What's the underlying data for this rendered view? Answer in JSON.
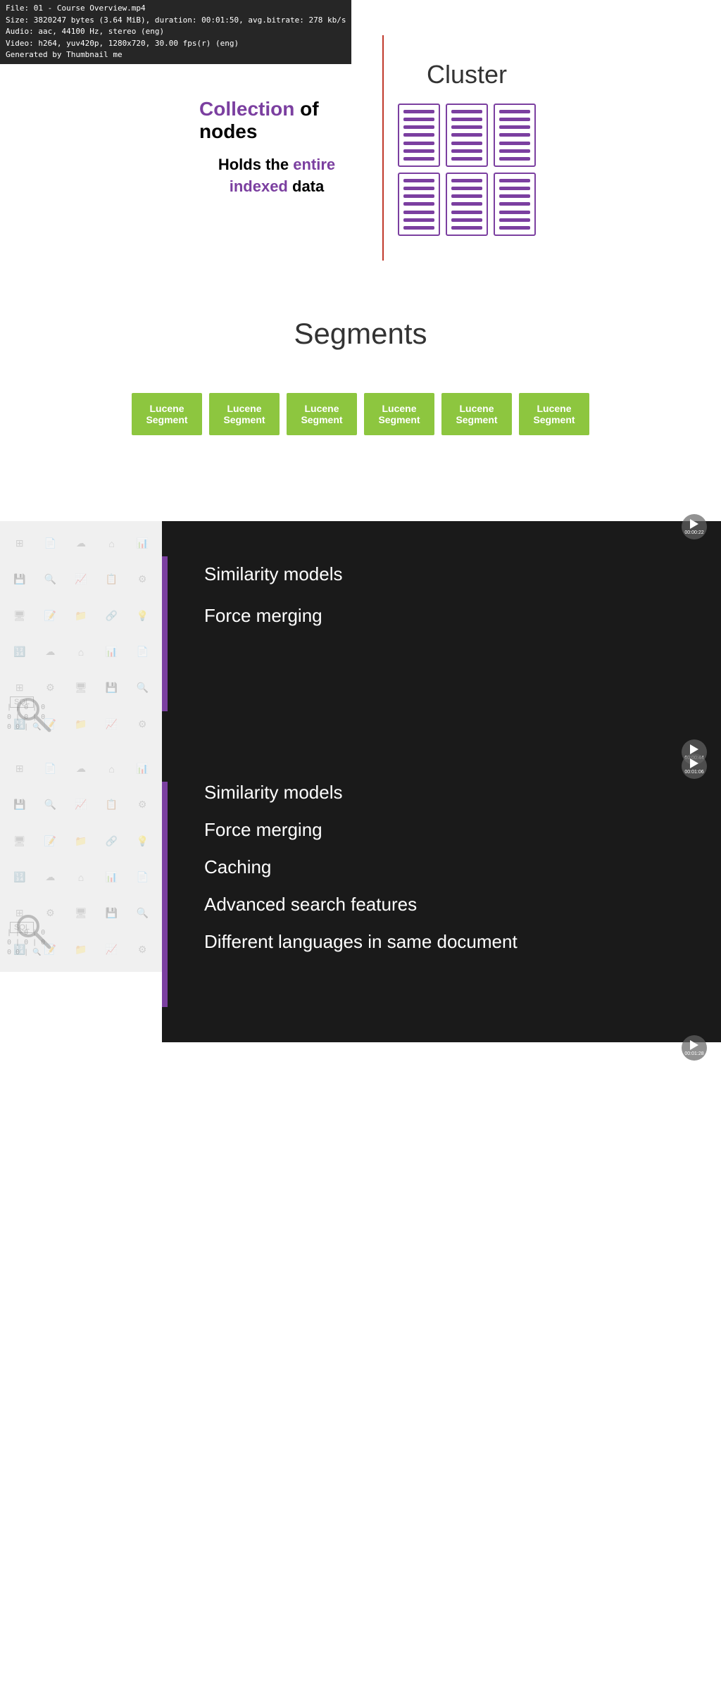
{
  "fileInfo": {
    "line1": "File: 01 - Course Overview.mp4",
    "line2": "Size: 3820247 bytes (3.64 MiB), duration: 00:01:50, avg.bitrate: 278 kb/s",
    "line3": "Audio: aac, 44100 Hz, stereo (eng)",
    "line4": "Video: h264, yuv420p, 1280x720, 30.00 fps(r) (eng)",
    "line5": "Generated by Thumbnail me"
  },
  "section1": {
    "title": "Cluster",
    "leftText1": "Collection of nodes",
    "leftText2_prefix": "Holds the",
    "leftText2_highlight": "entire indexed",
    "leftText2_suffix": "data"
  },
  "section2": {
    "title": "Segments",
    "segments": [
      {
        "label": "Lucene Segment"
      },
      {
        "label": "Lucene Segment"
      },
      {
        "label": "Lucene Segment"
      },
      {
        "label": "Lucene Segment"
      },
      {
        "label": "Lucene Segment"
      },
      {
        "label": "Lucene Segment"
      }
    ],
    "timestamp": "00:00:22"
  },
  "section3": {
    "timestamp": "00:00:44",
    "topics": [
      "Similarity models",
      "Force merging"
    ]
  },
  "section4": {
    "timestamp": "00:01:06",
    "topics": [
      "Similarity models",
      "Force merging",
      "Caching",
      "Advanced search features",
      "Different languages in same document"
    ],
    "timestamp2": "00:01:28"
  },
  "icons": {
    "patternIcons": [
      "📊",
      "📄",
      "🔧",
      "☁",
      "🏠",
      "💾",
      "🔍",
      "📈",
      "📋",
      "📁",
      "⚙",
      "🖥",
      "📝",
      "🔗",
      "💡",
      "📊",
      "🔢",
      "🔍",
      "📋",
      "📄",
      "☁",
      "🔧",
      "🏠",
      "💾",
      "🖥",
      "🔢",
      "🔍",
      "📝",
      "📁",
      "⚙"
    ]
  }
}
